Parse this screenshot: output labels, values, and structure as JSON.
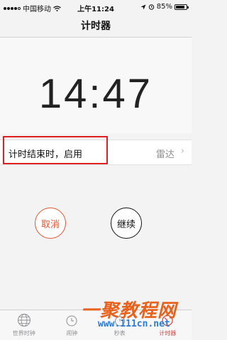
{
  "status": {
    "carrier": "中国移动",
    "time": "上午11:24",
    "battery": "85%",
    "battery_level": 0.85
  },
  "nav": {
    "title": "计时器"
  },
  "timer": {
    "display": "14:47"
  },
  "sound_row": {
    "label": "计时结束时，启用",
    "value": "雷达"
  },
  "buttons": {
    "cancel": "取消",
    "resume": "继续"
  },
  "tabs": [
    {
      "label": "世界时钟",
      "icon": "globe-icon",
      "active": false
    },
    {
      "label": "闹钟",
      "icon": "alarm-icon",
      "active": false
    },
    {
      "label": "秒表",
      "icon": "stopwatch-icon",
      "active": false
    },
    {
      "label": "计时器",
      "icon": "timer-icon",
      "active": true
    }
  ],
  "watermark": {
    "main": "一聚教程网",
    "url": "www.111cn.net"
  },
  "colors": {
    "accent_red": "#e25533",
    "highlight_box": "#e02020",
    "active_tab": "#e0403a"
  }
}
